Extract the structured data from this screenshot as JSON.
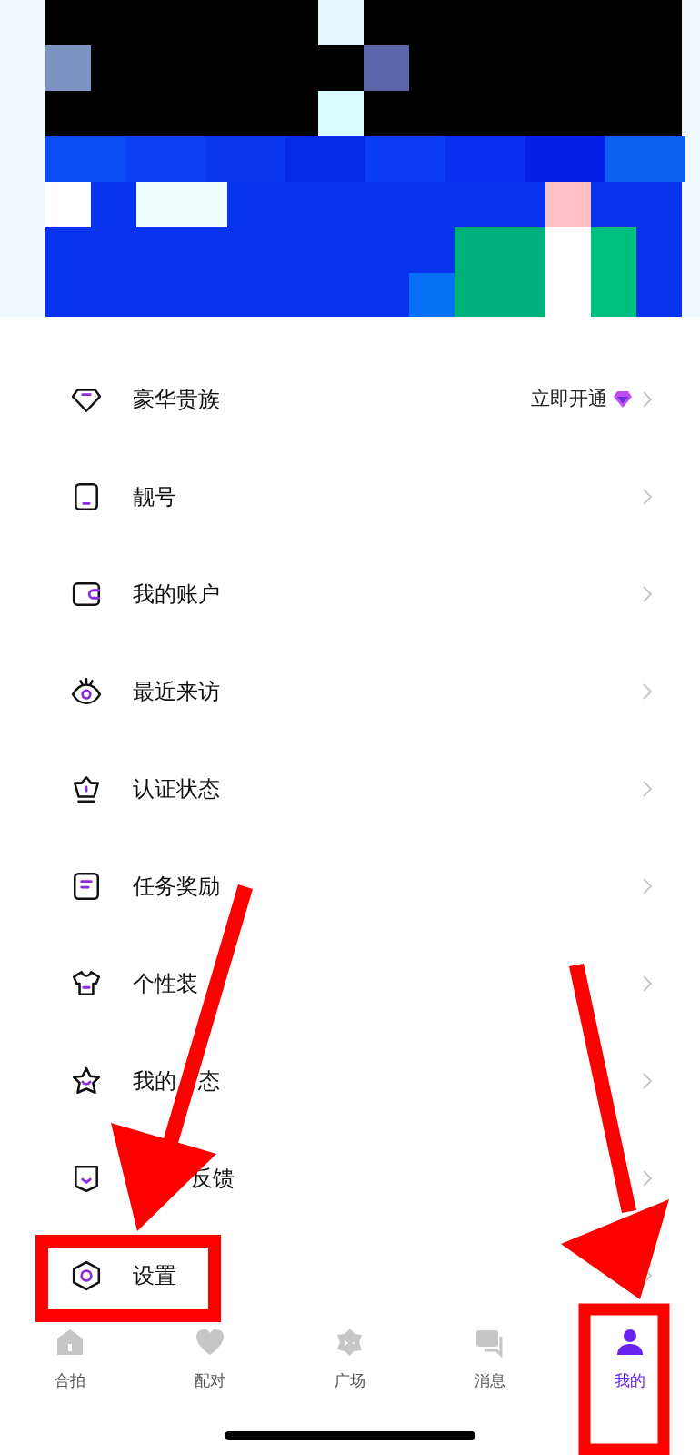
{
  "menu": [
    {
      "kind": "plain",
      "label": "豪华贵族",
      "action": "立即开通"
    },
    {
      "kind": "plain",
      "label": "靓号"
    },
    {
      "kind": "plain",
      "label": "我的账户"
    },
    {
      "kind": "plain",
      "label": "最近来访"
    },
    {
      "kind": "plain",
      "label": "认证状态"
    },
    {
      "kind": "plain",
      "label": "任务奖励"
    },
    {
      "kind": "plain",
      "label": "个性装"
    },
    {
      "kind": "split",
      "label": "我的",
      "tail": "态"
    },
    {
      "kind": "lead_covered",
      "label": "反馈"
    },
    {
      "kind": "plain",
      "label": "设置"
    }
  ],
  "tabs": [
    {
      "label": "合拍",
      "selected": false
    },
    {
      "label": "配对",
      "selected": false
    },
    {
      "label": "广场",
      "selected": false
    },
    {
      "label": "消息",
      "selected": false
    },
    {
      "label": "我的",
      "selected": true
    }
  ]
}
